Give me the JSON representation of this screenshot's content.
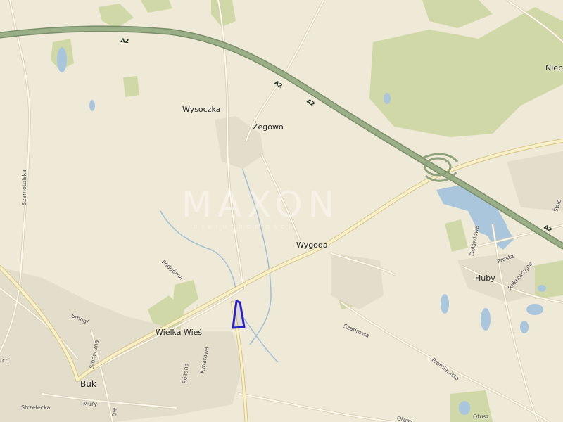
{
  "map": {
    "colors": {
      "background": "#efe9d7",
      "forest": "#cfd8a6",
      "water": "#a9c6dd",
      "motorway": "#8ea27c",
      "road": "#fbf8ee",
      "road_casing": "#d8ccb0",
      "built": "#e3ddcc",
      "marker": "#2b21c9"
    },
    "watermark": {
      "brand": "MAXON",
      "subtitle": "nieruchomości"
    },
    "road_number": "A2",
    "places": {
      "wysoczka": "Wysoczka",
      "zegowo": "Żegowo",
      "wygoda": "Wygoda",
      "wielka_wies": "Wielka Wieś",
      "buk": "Buk",
      "huby": "Huby",
      "niep": "Niep"
    },
    "streets": {
      "szamotulska": "Szamotulska",
      "podgorna": "Podgórna",
      "smugi": "Smugi",
      "sloneczna": "Słoneczna",
      "kwiatowa": "Kwiatowa",
      "rozana": "Różana",
      "strzelecka": "Strzelecka",
      "mury": "Mury",
      "dw": "Dw",
      "rch": "rch",
      "szafirowa": "Szafirowa",
      "promienista": "Promienista",
      "dojazdowa": "Dojazdowa",
      "prosta": "Prosta",
      "rekreacyjna": "Rekreacyjna",
      "swie": "Świe",
      "otusz1": "Otusz",
      "otusz2": "Otusz"
    }
  }
}
